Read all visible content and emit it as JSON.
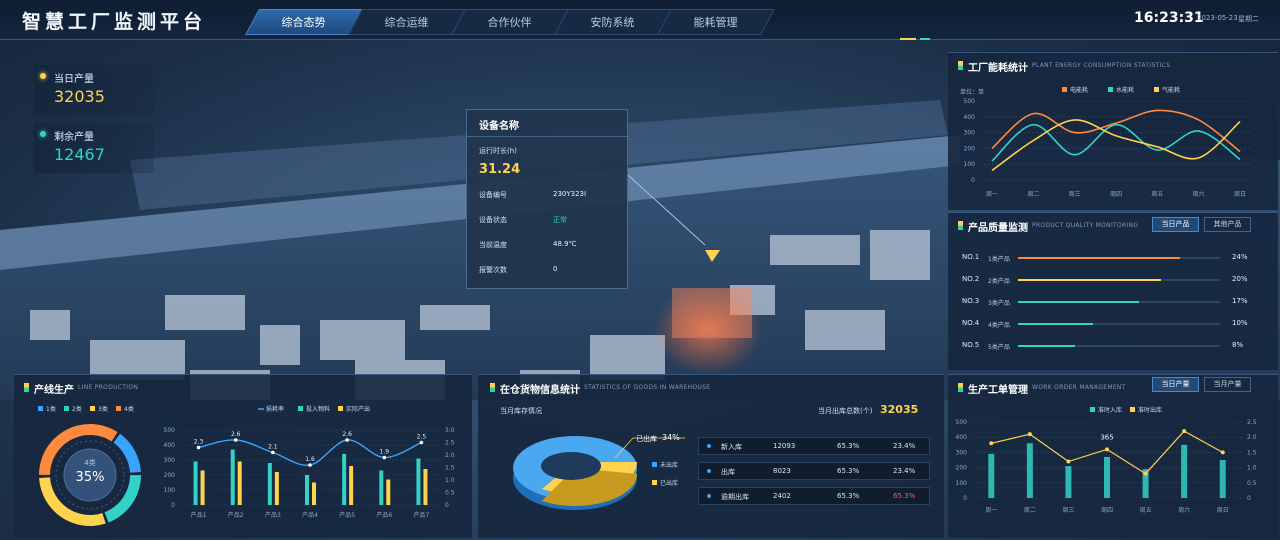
{
  "header": {
    "title": "智慧工厂监测平台",
    "tabs": [
      {
        "label": "综合态势",
        "active": true
      },
      {
        "label": "综合运维",
        "active": false
      },
      {
        "label": "合作伙伴",
        "active": false
      },
      {
        "label": "安防系统",
        "active": false
      },
      {
        "label": "能耗管理",
        "active": false
      }
    ],
    "time": "16:23:31",
    "date": "2023-05-23",
    "weekday": "星期二"
  },
  "stats": {
    "today_output": {
      "label": "当日产量",
      "value": "32035",
      "color": "#ffd34d"
    },
    "remaining_output": {
      "label": "剩余产量",
      "value": "12467",
      "color": "#33d1c6"
    }
  },
  "device_popup": {
    "title": "设备名称",
    "runtime_label": "运行时长(h)",
    "runtime_value": "31.24",
    "rows": [
      {
        "label": "设备编号",
        "value": "230Y323I"
      },
      {
        "label": "设备状态",
        "value": "正常"
      },
      {
        "label": "当前温度",
        "value": "48.9℃"
      },
      {
        "label": "报警次数",
        "value": "0"
      }
    ]
  },
  "energy_panel": {
    "title": "工厂能耗统计",
    "subtitle": "PLANT ENERGY CONSUMPTION STATISTICS",
    "unit_label": "单位：单"
  },
  "quality_panel": {
    "title": "产品质量监测",
    "subtitle": "PRODUCT QUALITY MONITORING",
    "btn_today": "当日产品",
    "btn_other": "其他产品",
    "rows": [
      {
        "no": "NO.1",
        "name": "1类产品",
        "pct": "24%",
        "frac": 0.8,
        "color": "#ff8a3d"
      },
      {
        "no": "NO.2",
        "name": "2类产品",
        "pct": "20%",
        "frac": 0.71,
        "color": "#ffd34d"
      },
      {
        "no": "NO.3",
        "name": "3类产品",
        "pct": "17%",
        "frac": 0.6,
        "color": "#33d1c6"
      },
      {
        "no": "NO.4",
        "name": "4类产品",
        "pct": "10%",
        "frac": 0.37,
        "color": "#33d1c6"
      },
      {
        "no": "NO.5",
        "name": "5类产品",
        "pct": "8%",
        "frac": 0.28,
        "color": "#33d1c6"
      }
    ]
  },
  "line_panel": {
    "title": "产线生产",
    "subtitle": "LINE PRODUCTION",
    "donut_label": "4类",
    "donut_value": "35%",
    "donut_legend": [
      {
        "name": "1类",
        "color": "#3aa3ff"
      },
      {
        "name": "2类",
        "color": "#33d1c6"
      },
      {
        "name": "3类",
        "color": "#ffd34d"
      },
      {
        "name": "4类",
        "color": "#ff8a3d"
      }
    ]
  },
  "warehouse_panel": {
    "title": "在仓货物信息统计",
    "subtitle": "STATISTICS OF GOODS IN WAREHOUSE",
    "month_stock_label": "当月库存情况",
    "month_total_label": "当月出库总数(个)",
    "month_total_value": "32035",
    "out_label": "已出库",
    "out_pct": "34%",
    "legend_not_out": "未出库",
    "legend_out": "已出库",
    "rows": [
      {
        "name": "新入库",
        "count": "12093",
        "pct1": "65.3%",
        "pct2": "23.4%",
        "alert": false
      },
      {
        "name": "出库",
        "count": "8023",
        "pct1": "65.3%",
        "pct2": "23.4%",
        "alert": false
      },
      {
        "name": "逾期出库",
        "count": "2402",
        "pct1": "65.3%",
        "pct2": "65.3%",
        "alert": true
      }
    ]
  },
  "workorder_panel": {
    "title": "生产工单管理",
    "subtitle": "WORK ORDER MANAGEMENT",
    "btn_today": "当日产量",
    "btn_month": "当月产量"
  },
  "chart_data": [
    {
      "id": "energy",
      "type": "line",
      "categories": [
        "周一",
        "周二",
        "周三",
        "周四",
        "周五",
        "周六",
        "周日"
      ],
      "series": [
        {
          "name": "电能耗",
          "color": "#ff8a3d",
          "values": [
            200,
            420,
            300,
            360,
            440,
            380,
            180
          ]
        },
        {
          "name": "水能耗",
          "color": "#33d1c6",
          "values": [
            120,
            350,
            160,
            350,
            190,
            310,
            130
          ]
        },
        {
          "name": "气能耗",
          "color": "#ffd34d",
          "values": [
            60,
            250,
            380,
            280,
            210,
            140,
            370
          ]
        }
      ],
      "ylim": [
        0,
        500
      ],
      "yticks": [
        0,
        100,
        200,
        300,
        400,
        500
      ],
      "grid": true,
      "legend_position": "top"
    },
    {
      "id": "line_production",
      "type": "bar",
      "categories": [
        "产品1",
        "产品2",
        "产品3",
        "产品4",
        "产品5",
        "产品6",
        "产品7"
      ],
      "series": [
        {
          "name": "投入物料",
          "color": "#33d1c6",
          "values": [
            290,
            370,
            280,
            200,
            340,
            230,
            310
          ]
        },
        {
          "name": "实际产出",
          "color": "#ffd34d",
          "values": [
            230,
            290,
            220,
            150,
            260,
            170,
            240
          ]
        }
      ],
      "line_series": {
        "name": "损耗率",
        "color": "#3aa3ff",
        "values": [
          2.3,
          2.6,
          2.1,
          1.6,
          2.6,
          1.9,
          2.5
        ]
      },
      "ylim": [
        0,
        500
      ],
      "yticks": [
        0,
        100,
        200,
        300,
        400,
        500
      ],
      "y2lim": [
        0,
        3.0
      ],
      "y2ticks": [
        "0",
        "0.5",
        "1.0",
        "1.5",
        "2.0",
        "2.5",
        "3.0"
      ]
    },
    {
      "id": "line_donut",
      "type": "pie",
      "labels": [
        "1类",
        "2类",
        "3类",
        "4类"
      ],
      "values": [
        15,
        20,
        30,
        35
      ],
      "colors": [
        "#3aa3ff",
        "#33d1c6",
        "#ffd34d",
        "#ff8a3d"
      ]
    },
    {
      "id": "warehouse_donut",
      "type": "pie",
      "labels": [
        "未出库",
        "已出库"
      ],
      "values": [
        66,
        34
      ],
      "colors": [
        "#3aa3ff",
        "#ffd34d"
      ]
    },
    {
      "id": "work_order",
      "type": "bar",
      "categories": [
        "周一",
        "周二",
        "周三",
        "周四",
        "周五",
        "周六",
        "周日"
      ],
      "series": [
        {
          "name": "准时入库",
          "color": "#33d1c6",
          "values": [
            290,
            360,
            210,
            270,
            190,
            350,
            250
          ]
        }
      ],
      "line_series": {
        "name": "准时出库",
        "color": "#ffd34d",
        "values": [
          1.8,
          2.1,
          1.2,
          1.6,
          0.8,
          2.2,
          1.5
        ]
      },
      "annotation": "365",
      "ylim": [
        0,
        500
      ],
      "yticks": [
        0,
        100,
        200,
        300,
        400,
        500
      ],
      "y2lim": [
        0,
        2.5
      ],
      "y2ticks": [
        "0",
        "0.5",
        "1.0",
        "1.5",
        "2.0",
        "2.5"
      ]
    }
  ]
}
